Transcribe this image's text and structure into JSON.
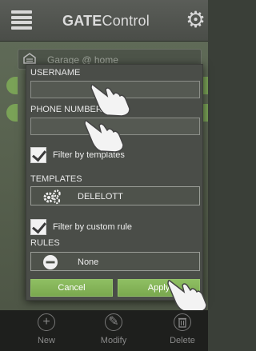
{
  "header": {
    "title_bold": "GATE",
    "title_rest": "Control",
    "menu_icon": "hamburger-menu-icon",
    "settings_icon": "gear-icon"
  },
  "background": {
    "device_label": "Garage @ home",
    "device_icon": "garage-icon"
  },
  "dialog": {
    "username": {
      "label": "USERNAME",
      "value": ""
    },
    "phone": {
      "label": "PHONE NUMBER",
      "value": ""
    },
    "filter_templates": {
      "label": "Filter by templates",
      "checked": true
    },
    "templates": {
      "label": "TEMPLATES",
      "value": "DELELOTT",
      "icon": "gears-icon"
    },
    "filter_rule": {
      "label": "Filter by custom rule",
      "checked": true
    },
    "rules": {
      "label": "RULES",
      "value": "None",
      "icon": "minus-circle-icon"
    },
    "cancel_label": "Cancel",
    "apply_label": "Apply"
  },
  "bottom_bar": {
    "items": [
      {
        "label": "New",
        "icon": "plus-circle-icon"
      },
      {
        "label": "Modify",
        "icon": "pencil-icon"
      },
      {
        "label": "Delete",
        "icon": "trash-icon"
      }
    ]
  },
  "colors": {
    "accent_green": "#7aa84f",
    "dialog_bg": "#4a4d48",
    "topbar_bg": "#525550",
    "bottombar_bg": "#1e1f1d"
  }
}
